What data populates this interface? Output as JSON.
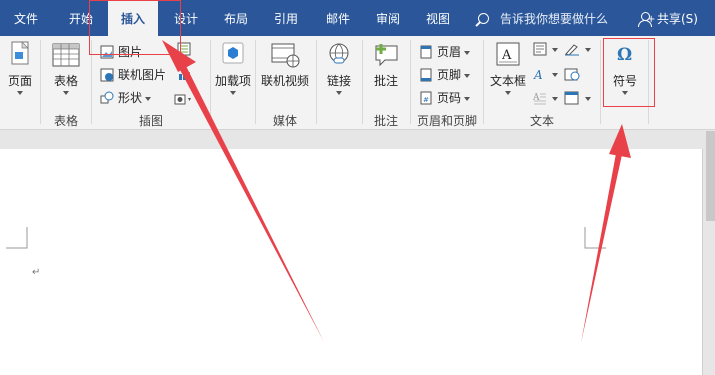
{
  "tabs": [
    {
      "label": "文件"
    },
    {
      "label": "开始"
    },
    {
      "label": "插入"
    },
    {
      "label": "设计"
    },
    {
      "label": "布局"
    },
    {
      "label": "引用"
    },
    {
      "label": "邮件"
    },
    {
      "label": "审阅"
    },
    {
      "label": "视图"
    }
  ],
  "active_tab": "插入",
  "tell_me": {
    "placeholder": "告诉我你想要做什么",
    "icon": "search-icon"
  },
  "share": {
    "label": "共享(S)",
    "icon": "person-add-icon"
  },
  "ribbon": {
    "groups": {
      "pages": {
        "label": ""
      },
      "tables": {
        "label": "表格"
      },
      "illustrations": {
        "label": "插图"
      },
      "media": {
        "label": "媒体"
      },
      "comments": {
        "label": "批注"
      },
      "header_footer": {
        "label": "页眉和页脚"
      },
      "text": {
        "label": "文本"
      }
    },
    "buttons": {
      "pages": "页面",
      "table": "表格",
      "pictures": "图片",
      "online_pictures": "联机图片",
      "shapes": "形状",
      "addins": "加载项",
      "online_video": "联机视频",
      "link": "链接",
      "comment": "批注",
      "header": "页眉",
      "footer": "页脚",
      "page_number": "页码",
      "text_box": "文本框",
      "symbol": "符号"
    }
  },
  "document": {
    "paragraph_mark": "↵"
  },
  "colors": {
    "tabbar": "#2b579a",
    "ribbon": "#f3f3f3",
    "annotation": "#e8414a",
    "active_tab_text": "#2b579a"
  }
}
